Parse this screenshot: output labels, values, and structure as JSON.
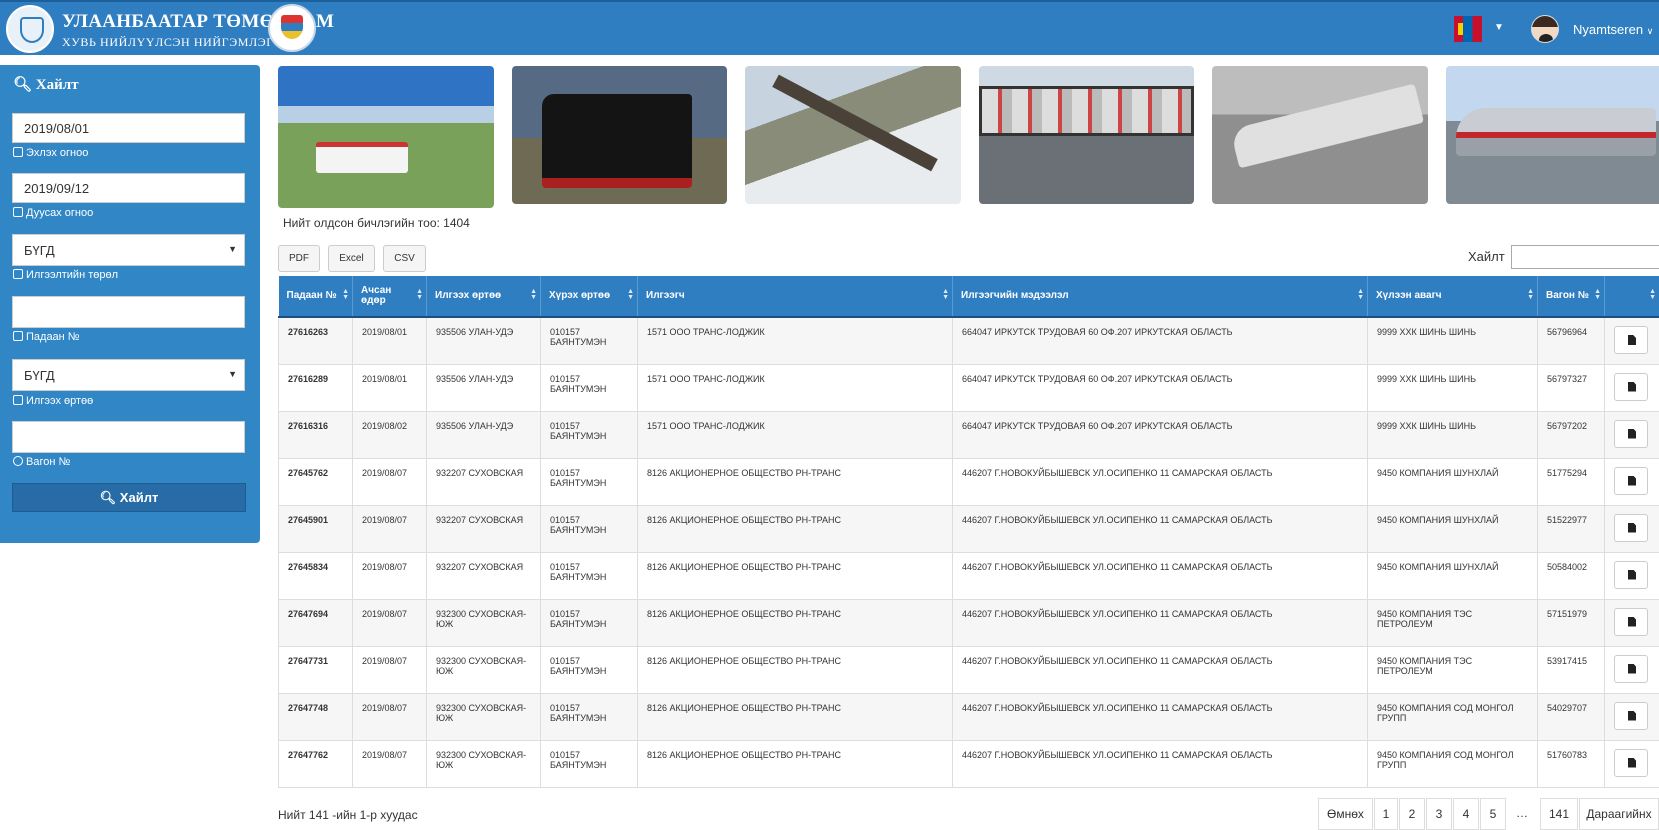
{
  "header": {
    "org_line1": "УЛААНБААТАР ТӨМӨР ЗАМ",
    "org_line2": "ХУВЬ НИЙЛҮҮЛСЭН НИЙГЭМЛЭГ",
    "user_name": "Nyamtseren"
  },
  "sidebar": {
    "title": "Хайлт",
    "start_date_value": "2019/08/01",
    "start_date_label": "Эхлэх огноо",
    "end_date_value": "2019/09/12",
    "end_date_label": "Дуусах огноо",
    "shipment_type_value": "БҮГД",
    "shipment_type_label": "Илгээлтийн төрөл",
    "invoice_no_value": "",
    "invoice_no_label": "Падаан №",
    "sender_station_value": "БҮГД",
    "sender_station_label": "Илгээх өртөө",
    "wagon_no_value": "",
    "wagon_no_label": "Вагон №",
    "search_button": "Хайлт"
  },
  "summary": {
    "total_text": "Нийт олдсон бичлэгийн тоо: 1404"
  },
  "toolbar": {
    "pdf": "PDF",
    "excel": "Excel",
    "csv": "CSV",
    "search_label": "Хайлт"
  },
  "table": {
    "headers": {
      "invoice": "Падаан №",
      "date": "Ачсан өдөр",
      "from": "Илгээх өртөө",
      "to": "Хүрэх өртөө",
      "sender": "Илгээгч",
      "sender_info": "Илгээгчийн мэдээлэл",
      "receiver": "Хүлээн авагч",
      "wagon": "Вагон №"
    },
    "rows": [
      {
        "invoice": "27616263",
        "date": "2019/08/01",
        "from": "935506 УЛАН-УДЭ",
        "to": "010157 БАЯНТУМЭН",
        "sender": "1571 ООО ТРАНС-ЛОДЖИК",
        "sender_info": "664047 ИРКУТСК ТРУДОВАЯ 60 ОФ.207 ИРКУТСКАЯ ОБЛАСТЬ",
        "receiver": "9999 ХХК ШИНЬ ШИНЬ",
        "wagon": "56796964"
      },
      {
        "invoice": "27616289",
        "date": "2019/08/01",
        "from": "935506 УЛАН-УДЭ",
        "to": "010157 БАЯНТУМЭН",
        "sender": "1571 ООО ТРАНС-ЛОДЖИК",
        "sender_info": "664047 ИРКУТСК ТРУДОВАЯ 60 ОФ.207 ИРКУТСКАЯ ОБЛАСТЬ",
        "receiver": "9999 ХХК ШИНЬ ШИНЬ",
        "wagon": "56797327"
      },
      {
        "invoice": "27616316",
        "date": "2019/08/02",
        "from": "935506 УЛАН-УДЭ",
        "to": "010157 БАЯНТУМЭН",
        "sender": "1571 ООО ТРАНС-ЛОДЖИК",
        "sender_info": "664047 ИРКУТСК ТРУДОВАЯ 60 ОФ.207 ИРКУТСКАЯ ОБЛАСТЬ",
        "receiver": "9999 ХХК ШИНЬ ШИНЬ",
        "wagon": "56797202"
      },
      {
        "invoice": "27645762",
        "date": "2019/08/07",
        "from": "932207 СУХОВСКАЯ",
        "to": "010157 БАЯНТУМЭН",
        "sender": "8126 АКЦИОНЕРНОЕ ОБЩЕСТВО РН-ТРАНС",
        "sender_info": "446207 Г.НОВОКУЙБЫШЕВСК УЛ.ОСИПЕНКО 11 САМАРСКАЯ ОБЛАСТЬ",
        "receiver": "9450 КОМПАНИЯ ШУНХЛАЙ",
        "wagon": "51775294"
      },
      {
        "invoice": "27645901",
        "date": "2019/08/07",
        "from": "932207 СУХОВСКАЯ",
        "to": "010157 БАЯНТУМЭН",
        "sender": "8126 АКЦИОНЕРНОЕ ОБЩЕСТВО РН-ТРАНС",
        "sender_info": "446207 Г.НОВОКУЙБЫШЕВСК УЛ.ОСИПЕНКО 11 САМАРСКАЯ ОБЛАСТЬ",
        "receiver": "9450 КОМПАНИЯ ШУНХЛАЙ",
        "wagon": "51522977"
      },
      {
        "invoice": "27645834",
        "date": "2019/08/07",
        "from": "932207 СУХОВСКАЯ",
        "to": "010157 БАЯНТУМЭН",
        "sender": "8126 АКЦИОНЕРНОЕ ОБЩЕСТВО РН-ТРАНС",
        "sender_info": "446207 Г.НОВОКУЙБЫШЕВСК УЛ.ОСИПЕНКО 11 САМАРСКАЯ ОБЛАСТЬ",
        "receiver": "9450 КОМПАНИЯ ШУНХЛАЙ",
        "wagon": "50584002"
      },
      {
        "invoice": "27647694",
        "date": "2019/08/07",
        "from": "932300 СУХОВСКАЯ-ЮЖ",
        "to": "010157 БАЯНТУМЭН",
        "sender": "8126 АКЦИОНЕРНОЕ ОБЩЕСТВО РН-ТРАНС",
        "sender_info": "446207 Г.НОВОКУЙБЫШЕВСК УЛ.ОСИПЕНКО 11 САМАРСКАЯ ОБЛАСТЬ",
        "receiver": "9450 КОМПАНИЯ ТЭС ПЕТРОЛЕУМ",
        "wagon": "57151979"
      },
      {
        "invoice": "27647731",
        "date": "2019/08/07",
        "from": "932300 СУХОВСКАЯ-ЮЖ",
        "to": "010157 БАЯНТУМЭН",
        "sender": "8126 АКЦИОНЕРНОЕ ОБЩЕСТВО РН-ТРАНС",
        "sender_info": "446207 Г.НОВОКУЙБЫШЕВСК УЛ.ОСИПЕНКО 11 САМАРСКАЯ ОБЛАСТЬ",
        "receiver": "9450 КОМПАНИЯ ТЭС ПЕТРОЛЕУМ",
        "wagon": "53917415"
      },
      {
        "invoice": "27647748",
        "date": "2019/08/07",
        "from": "932300 СУХОВСКАЯ-ЮЖ",
        "to": "010157 БАЯНТУМЭН",
        "sender": "8126 АКЦИОНЕРНОЕ ОБЩЕСТВО РН-ТРАНС",
        "sender_info": "446207 Г.НОВОКУЙБЫШЕВСК УЛ.ОСИПЕНКО 11 САМАРСКАЯ ОБЛАСТЬ",
        "receiver": "9450 КОМПАНИЯ СОД МОНГОЛ ГРУПП",
        "wagon": "54029707"
      },
      {
        "invoice": "27647762",
        "date": "2019/08/07",
        "from": "932300 СУХОВСКАЯ-ЮЖ",
        "to": "010157 БАЯНТУМЭН",
        "sender": "8126 АКЦИОНЕРНОЕ ОБЩЕСТВО РН-ТРАНС",
        "sender_info": "446207 Г.НОВОКУЙБЫШЕВСК УЛ.ОСИПЕНКО 11 САМАРСКАЯ ОБЛАСТЬ",
        "receiver": "9450 КОМПАНИЯ СОД МОНГОЛ ГРУПП",
        "wagon": "51760783"
      }
    ]
  },
  "pagination": {
    "info": "Нийт 141 -ийн 1-р хуудас",
    "prev": "Өмнөх",
    "pages": [
      "1",
      "2",
      "3",
      "4",
      "5"
    ],
    "ellipsis": "…",
    "last": "141",
    "next": "Дараагийнх"
  }
}
